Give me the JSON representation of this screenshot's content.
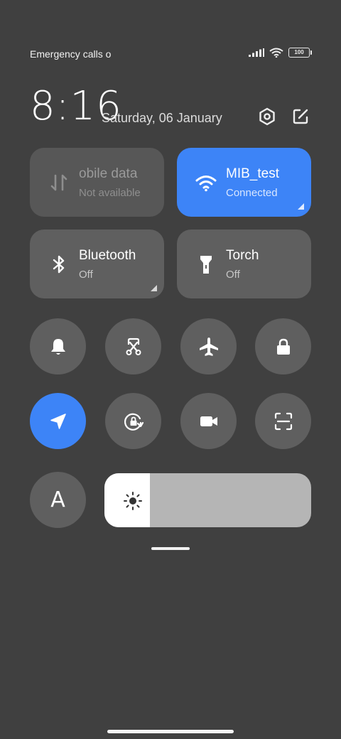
{
  "status_bar": {
    "carrier_text": "Emergency calls o",
    "battery_level": "100"
  },
  "header": {
    "time": "8:16",
    "date": "Saturday, 06 January"
  },
  "tiles": {
    "mobile_data": {
      "title": "obile data",
      "subtitle": "Not available"
    },
    "wifi": {
      "title": "MIB_test",
      "subtitle": "Connected"
    },
    "bluetooth": {
      "title": "Bluetooth",
      "subtitle": "Off"
    },
    "torch": {
      "title": "Torch",
      "subtitle": "Off"
    }
  },
  "toggles": {
    "font_label": "A"
  },
  "brightness": {
    "level": 0.22
  },
  "colors": {
    "background": "#404040",
    "tile": "#5f5f5f",
    "accent": "#3d84f7"
  },
  "icons": [
    "signal-icon",
    "wifi-icon",
    "battery-icon",
    "settings-icon",
    "edit-icon",
    "data-arrows-icon",
    "bluetooth-icon",
    "torch-icon",
    "bell-icon",
    "screenshot-icon",
    "airplane-icon",
    "lock-icon",
    "location-icon",
    "rotation-lock-icon",
    "video-camera-icon",
    "scan-icon",
    "sun-icon"
  ]
}
